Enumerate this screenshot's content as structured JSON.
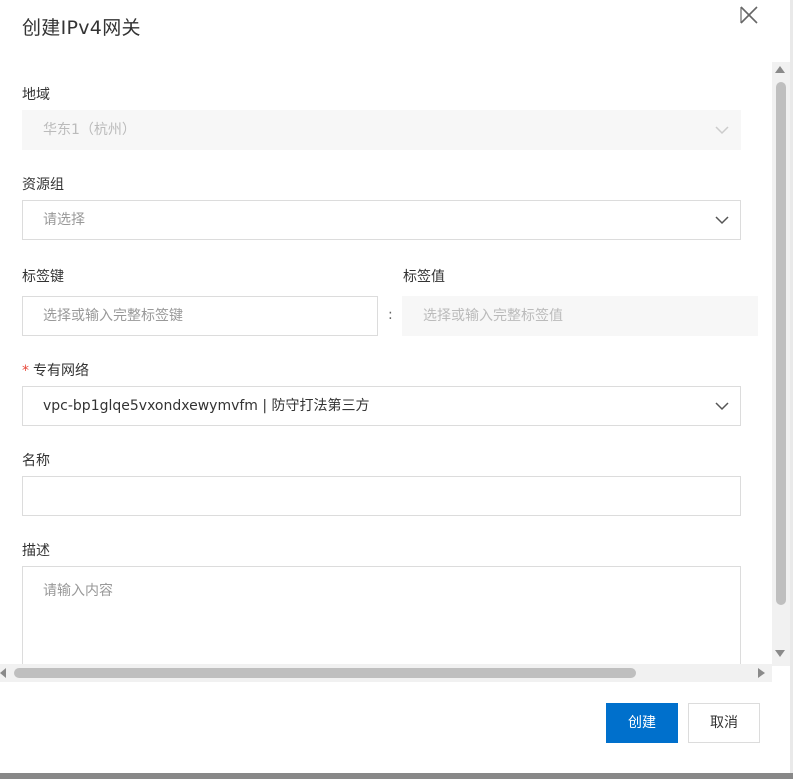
{
  "dialog": {
    "title": "创建IPv4网关",
    "close_icon": "close-icon"
  },
  "form": {
    "region": {
      "label": "地域",
      "value": "华东1（杭州）"
    },
    "resource_group": {
      "label": "资源组",
      "placeholder": "请选择"
    },
    "tag_key": {
      "label": "标签键",
      "placeholder": "选择或输入完整标签键"
    },
    "tag_separator": ":",
    "tag_value": {
      "label": "标签值",
      "placeholder": "选择或输入完整标签值"
    },
    "vpc": {
      "required_mark": "*",
      "label": "专有网络",
      "value": "vpc-bp1glqe5vxondxewymvfm | 防守打法第三方"
    },
    "name": {
      "label": "名称",
      "value": ""
    },
    "description": {
      "label": "描述",
      "placeholder": "请输入内容"
    }
  },
  "footer": {
    "create_label": "创建",
    "cancel_label": "取消"
  },
  "colors": {
    "primary": "#0070cc",
    "required": "#e84738",
    "border": "#dcdcdc",
    "disabled_bg": "#f7f7f7"
  }
}
